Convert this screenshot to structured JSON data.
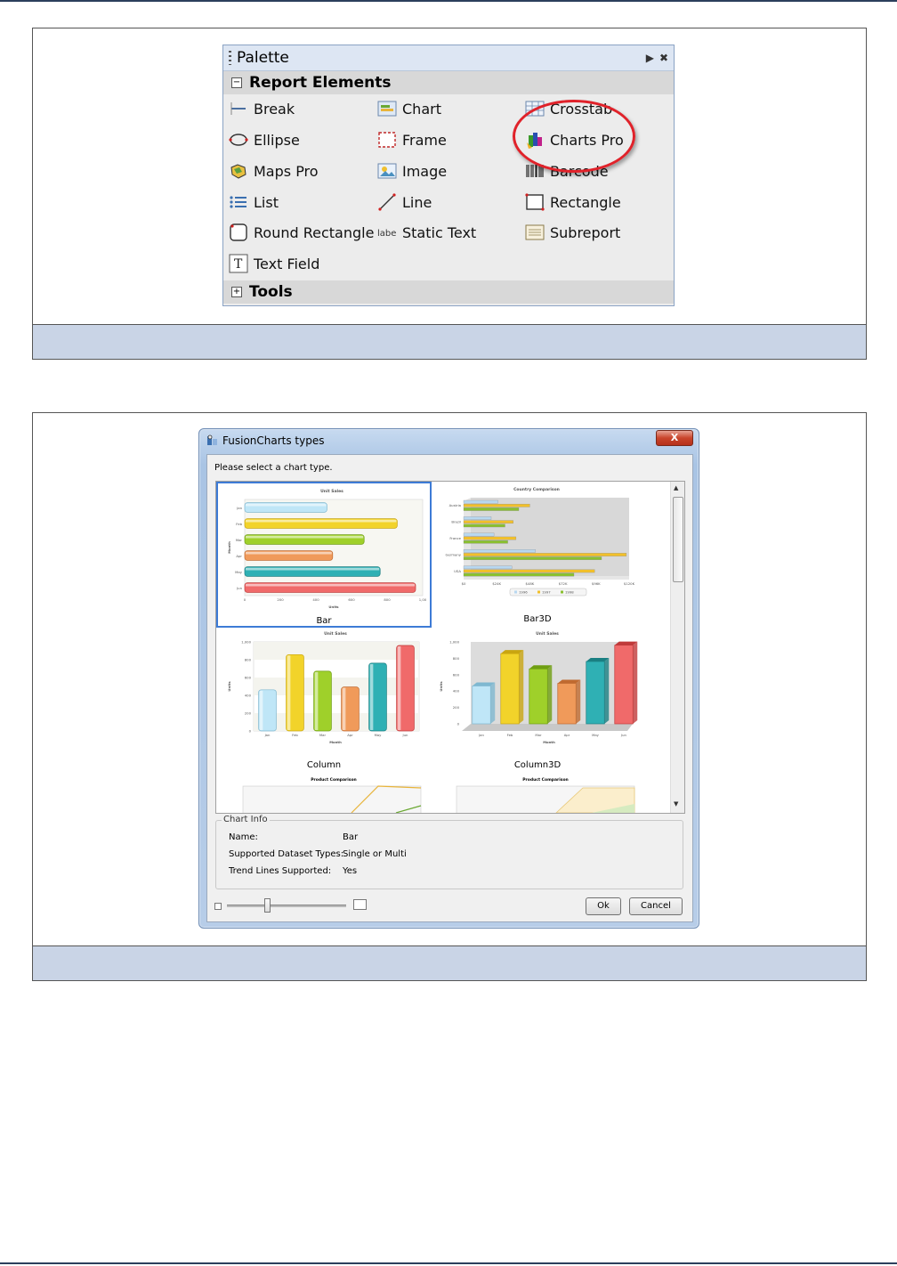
{
  "palette": {
    "title": "Palette",
    "section_report": "Report Elements",
    "section_tools": "Tools",
    "items": [
      {
        "label": "Break",
        "icon": "break-icon"
      },
      {
        "label": "Chart",
        "icon": "chart-icon"
      },
      {
        "label": "Crosstab",
        "icon": "crosstab-icon"
      },
      {
        "label": "Ellipse",
        "icon": "ellipse-icon"
      },
      {
        "label": "Frame",
        "icon": "frame-icon"
      },
      {
        "label": "Charts Pro",
        "icon": "charts-pro-icon"
      },
      {
        "label": "Maps Pro",
        "icon": "maps-pro-icon"
      },
      {
        "label": "Image",
        "icon": "image-icon"
      },
      {
        "label": "Barcode",
        "icon": "barcode-icon"
      },
      {
        "label": "List",
        "icon": "list-icon"
      },
      {
        "label": "Line",
        "icon": "line-icon"
      },
      {
        "label": "Rectangle",
        "icon": "rectangle-icon"
      },
      {
        "label": "Round Rectangle",
        "icon": "round-rectangle-icon"
      },
      {
        "label": "Static Text",
        "icon": "static-text-icon"
      },
      {
        "label": "Subreport",
        "icon": "subreport-icon"
      },
      {
        "label": "Text Field",
        "icon": "text-field-icon"
      }
    ],
    "static_text_icon_label": "label"
  },
  "dialog": {
    "title": "FusionCharts types",
    "close": "X",
    "prompt": "Please select a chart type.",
    "thumbnails": [
      {
        "label": "Bar",
        "title": "Unit Sales",
        "selected": true
      },
      {
        "label": "Bar3D",
        "title": "Country Comparison",
        "selected": false
      },
      {
        "label": "Column",
        "title": "Unit Sales",
        "selected": false
      },
      {
        "label": "Column3D",
        "title": "Unit Sales",
        "selected": false
      },
      {
        "label": "",
        "title": "Product Comparison",
        "selected": false
      },
      {
        "label": "",
        "title": "Product Comparison",
        "selected": false
      }
    ],
    "chart_info": {
      "legend": "Chart Info",
      "name_label": "Name:",
      "name_value": "Bar",
      "datasets_label": "Supported Dataset Types:",
      "datasets_value": "Single or Multi",
      "trend_label": "Trend Lines Supported:",
      "trend_value": "Yes"
    },
    "ok": "Ok",
    "cancel": "Cancel",
    "colors": {
      "selection": "#3d7bd6"
    }
  },
  "chart_data": [
    {
      "type": "bar",
      "title": "Unit Sales",
      "xlabel": "Units",
      "ylabel": "Month",
      "categories": [
        "Jan",
        "Feb",
        "Mar",
        "Apr",
        "May",
        "Jun"
      ],
      "values": [
        462,
        857,
        671,
        494,
        761,
        960
      ],
      "xlim": [
        0,
        1000
      ],
      "ticks": [
        "0",
        "200",
        "400",
        "600",
        "800",
        "1,00"
      ]
    },
    {
      "type": "bar",
      "title": "Country Comparison",
      "categories": [
        "Austria",
        "Brazil",
        "France",
        "Germany",
        "USA"
      ],
      "series": [
        {
          "name": "1996",
          "values": [
            25000,
            20000,
            22000,
            52000,
            35000
          ]
        },
        {
          "name": "1997",
          "values": [
            48000,
            36000,
            38000,
            118000,
            95000
          ]
        },
        {
          "name": "1998",
          "values": [
            40000,
            30000,
            32000,
            100000,
            80000
          ]
        }
      ],
      "ticks": [
        "$0",
        "$24K",
        "$48K",
        "$72K",
        "$96K",
        "$120K"
      ],
      "xlim": [
        0,
        120000
      ]
    },
    {
      "type": "bar",
      "title": "Unit Sales",
      "xlabel": "Month",
      "ylabel": "Units",
      "categories": [
        "Jan",
        "Feb",
        "Mar",
        "Apr",
        "May",
        "Jun"
      ],
      "values": [
        462,
        857,
        671,
        494,
        761,
        960
      ],
      "ylim": [
        0,
        1000
      ],
      "ticks": [
        "0",
        "200",
        "400",
        "600",
        "800",
        "1,000"
      ]
    },
    {
      "type": "bar",
      "title": "Unit Sales",
      "xlabel": "Month",
      "ylabel": "Units",
      "categories": [
        "Jan",
        "Feb",
        "Mar",
        "Apr",
        "May",
        "Jun"
      ],
      "values": [
        462,
        857,
        671,
        494,
        761,
        960
      ],
      "ylim": [
        0,
        1000
      ],
      "ticks": [
        "0",
        "200",
        "400",
        "600",
        "800",
        "1,000"
      ]
    }
  ]
}
